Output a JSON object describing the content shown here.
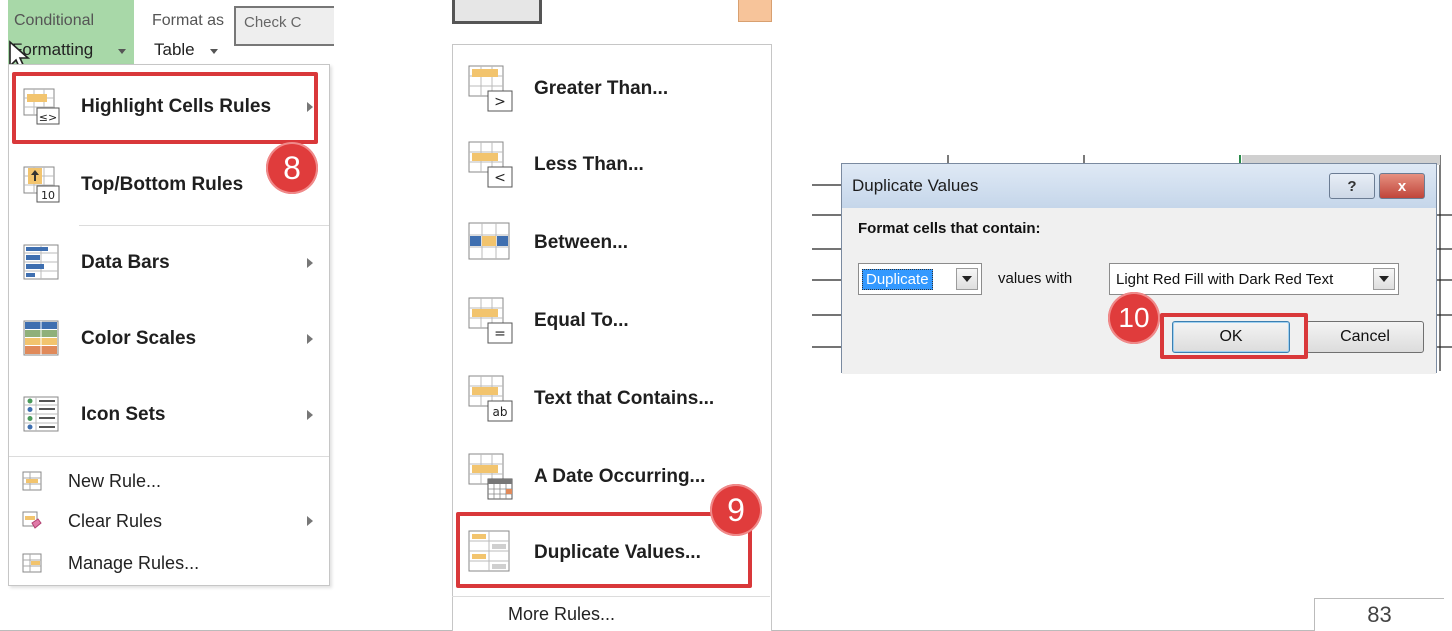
{
  "ribbon": {
    "cf_label": "Formatting",
    "cf_top": "Conditional",
    "ft_label": "Table",
    "ft_top": "Format as",
    "cs_label": "Check C"
  },
  "cf_menu": {
    "items": [
      {
        "label": "Highlight Cells Rules",
        "icon": "highlight-cells-icon",
        "submenu": true
      },
      {
        "label": "Top/Bottom Rules",
        "icon": "top-bottom-icon",
        "submenu": true
      },
      {
        "label": "Data Bars",
        "icon": "data-bars-icon",
        "submenu": true
      },
      {
        "label": "Color Scales",
        "icon": "color-scales-icon",
        "submenu": true
      },
      {
        "label": "Icon Sets",
        "icon": "icon-sets-icon",
        "submenu": true
      }
    ],
    "small_items": [
      {
        "label": "New Rule...",
        "icon": "new-rule-icon"
      },
      {
        "label": "Clear Rules",
        "icon": "clear-rules-icon",
        "submenu": true
      },
      {
        "label": "Manage Rules...",
        "icon": "manage-rules-icon"
      }
    ]
  },
  "highlight_menu": {
    "items": [
      {
        "label": "Greater Than...",
        "icon": "greater-than-icon",
        "glyph": ">"
      },
      {
        "label": "Less Than...",
        "icon": "less-than-icon",
        "glyph": "<"
      },
      {
        "label": "Between...",
        "icon": "between-icon",
        "glyph": ""
      },
      {
        "label": "Equal To...",
        "icon": "equal-to-icon",
        "glyph": "="
      },
      {
        "label": "Text that Contains...",
        "icon": "text-contains-icon",
        "glyph": "ab"
      },
      {
        "label": "A Date Occurring...",
        "icon": "date-occurring-icon",
        "glyph": ""
      },
      {
        "label": "Duplicate Values...",
        "icon": "duplicate-values-icon",
        "glyph": ""
      }
    ],
    "more_rules": "More Rules..."
  },
  "dialog": {
    "title": "Duplicate Values",
    "help_label": "?",
    "close_label": "x",
    "prompt": "Format cells that contain:",
    "type_value": "Duplicate",
    "values_with": "values with",
    "format_value": "Light Red Fill with Dark Red Text",
    "ok_label": "OK",
    "cancel_label": "Cancel"
  },
  "steps": {
    "step8": "8",
    "step9": "9",
    "step10": "10"
  },
  "colors": {
    "highlight_red": "#d9383a",
    "badge_red": "#e03c3c",
    "ribbon_green": "#a8d8a8",
    "icon_orange": "#f2c46e"
  },
  "page_number": "83"
}
